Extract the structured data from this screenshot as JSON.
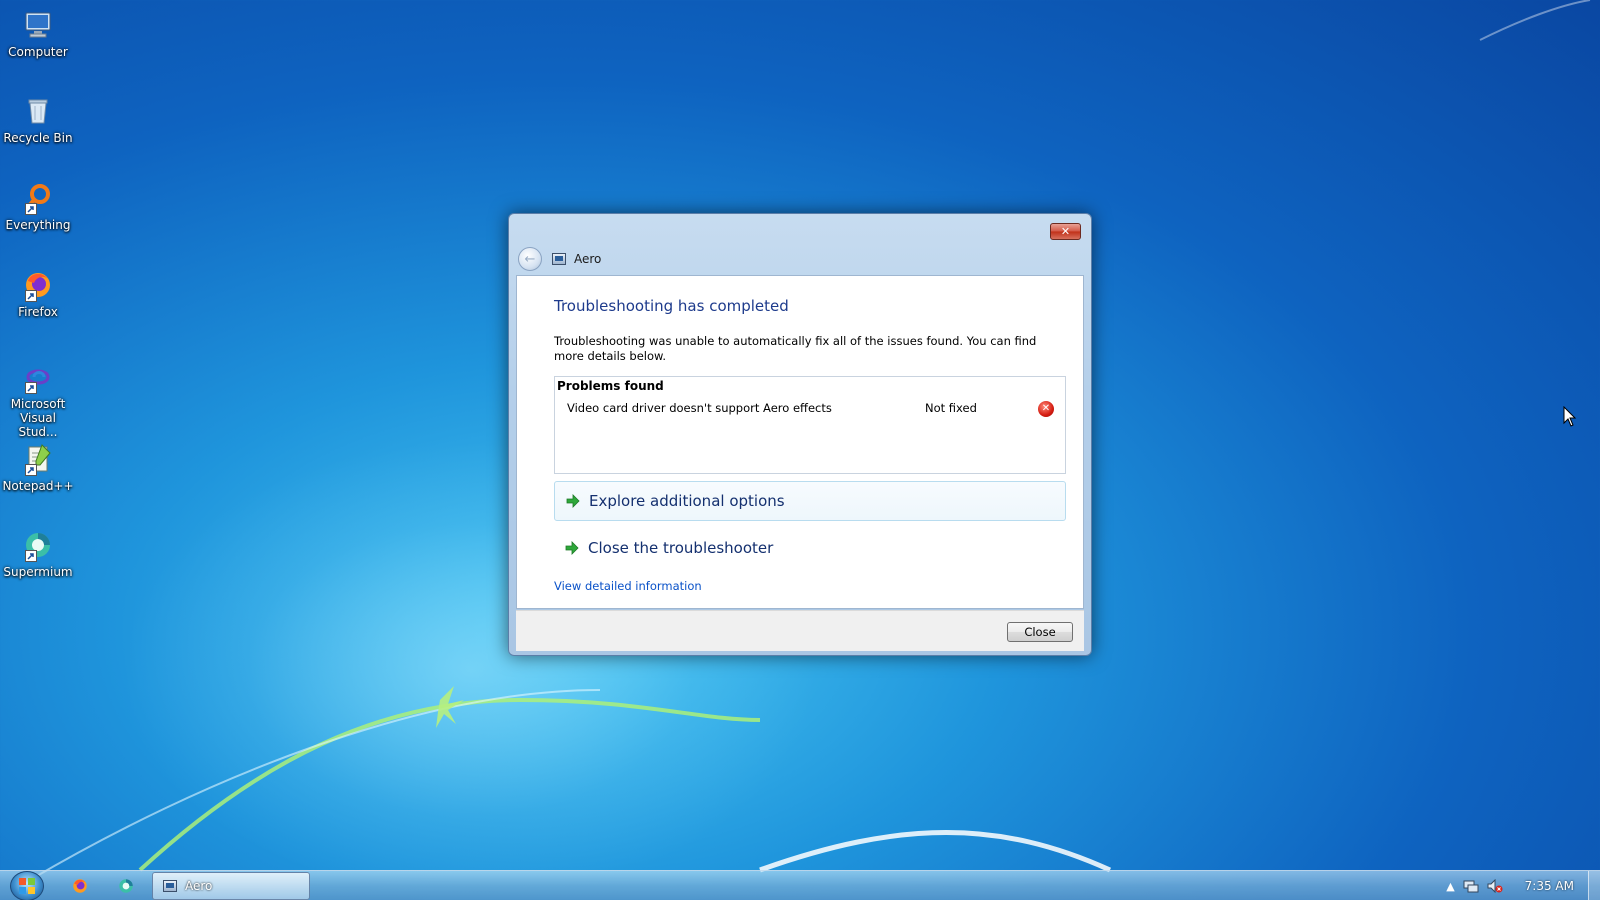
{
  "desktop": {
    "icons": [
      {
        "label": "Computer",
        "icon": "computer-icon"
      },
      {
        "label": "Recycle Bin",
        "icon": "recycle-bin-icon"
      },
      {
        "label": "Everything",
        "icon": "everything-icon"
      },
      {
        "label": "Firefox",
        "icon": "firefox-icon"
      },
      {
        "label": "Microsoft Visual Stud...",
        "icon": "visual-studio-icon"
      },
      {
        "label": "Notepad++",
        "icon": "notepadpp-icon"
      },
      {
        "label": "Supermium",
        "icon": "supermium-icon"
      }
    ]
  },
  "dialog": {
    "title": "Aero",
    "close_glyph": "✕",
    "heading": "Troubleshooting has completed",
    "description": "Troubleshooting was unable to automatically fix all of the issues found. You can find more details below.",
    "problems": {
      "header": "Problems found",
      "rows": [
        {
          "text": "Video card driver doesn't support Aero effects",
          "status": "Not fixed",
          "status_icon": "error-icon"
        }
      ]
    },
    "options": [
      {
        "label": "Explore additional options",
        "icon": "green-arrow-icon"
      },
      {
        "label": "Close the troubleshooter",
        "icon": "green-arrow-icon"
      }
    ],
    "detail_link": "View detailed information",
    "close_button": "Close"
  },
  "taskbar": {
    "task_label": "Aero",
    "clock": "7:35 AM",
    "pinned": [
      "firefox-icon",
      "supermium-icon"
    ],
    "tray_icons": [
      "show-hidden-icons-icon",
      "network-icon",
      "volume-muted-icon"
    ]
  },
  "colors": {
    "heading": "#1e3b8c",
    "link": "#0a52c8",
    "desktop_accent": "#1f95dc"
  }
}
